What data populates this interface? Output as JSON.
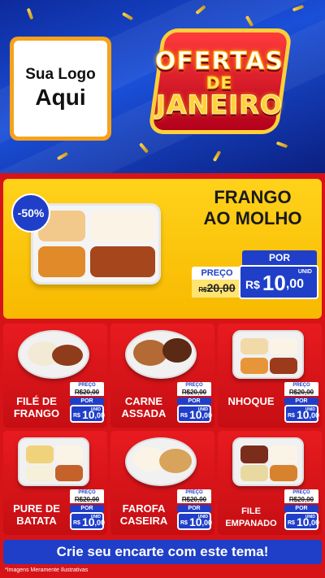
{
  "header": {
    "logo_line1": "Sua Logo",
    "logo_line2": "Aqui",
    "title_line1": "OFERTAS",
    "title_line2": "DE",
    "title_line3": "JANEIRO"
  },
  "hero": {
    "discount": "-50%",
    "name_line1": "FRANGO",
    "name_line2": "AO MOLHO",
    "preco_label": "PREÇO",
    "old_currency": "R$",
    "old_price": "20,00",
    "por_label": "POR",
    "currency": "R$",
    "price_int": "10",
    "price_cents": ",00",
    "unit": "UNID"
  },
  "products": [
    {
      "name_line1": "FILÉ DE",
      "name_line2": "FRANGO",
      "preco_label": "PREÇO",
      "old_price": "R$20,00",
      "por_label": "POR",
      "currency": "R$",
      "price_int": "10",
      "price_cents": ",00",
      "unit": "UNID"
    },
    {
      "name_line1": "CARNE",
      "name_line2": "ASSADA",
      "preco_label": "PREÇO",
      "old_price": "R$20,00",
      "por_label": "POR",
      "currency": "R$",
      "price_int": "10",
      "price_cents": ",00",
      "unit": "UNID"
    },
    {
      "name_line1": "",
      "name_line2": "NHOQUE",
      "preco_label": "PREÇO",
      "old_price": "R$20,00",
      "por_label": "POR",
      "currency": "R$",
      "price_int": "10",
      "price_cents": ",00",
      "unit": "UNID"
    },
    {
      "name_line1": "PURE DE",
      "name_line2": "BATATA",
      "preco_label": "PREÇO",
      "old_price": "R$20,00",
      "por_label": "POR",
      "currency": "R$",
      "price_int": "10",
      "price_cents": ",00",
      "unit": "UNID"
    },
    {
      "name_line1": "FAROFA",
      "name_line2": "CASEIRA",
      "preco_label": "PREÇO",
      "old_price": "R$20,00",
      "por_label": "POR",
      "currency": "R$",
      "price_int": "10",
      "price_cents": ",00",
      "unit": "UNID"
    },
    {
      "name_line1": "FILE",
      "name_line2": "EMPANADO",
      "preco_label": "PREÇO",
      "old_price": "R$20,00",
      "por_label": "POR",
      "currency": "R$",
      "price_int": "10",
      "price_cents": ",00",
      "unit": "UNID"
    }
  ],
  "cta": "Crie seu encarte com este tema!",
  "disclaimer": "*Imagens Meramente Ilustrativas",
  "colors": {
    "header_blue": "#1a4fd8",
    "background_red": "#d61418",
    "hero_yellow": "#ffd21a",
    "price_blue": "#1f3fc9",
    "logo_orange": "#f6a21a"
  }
}
